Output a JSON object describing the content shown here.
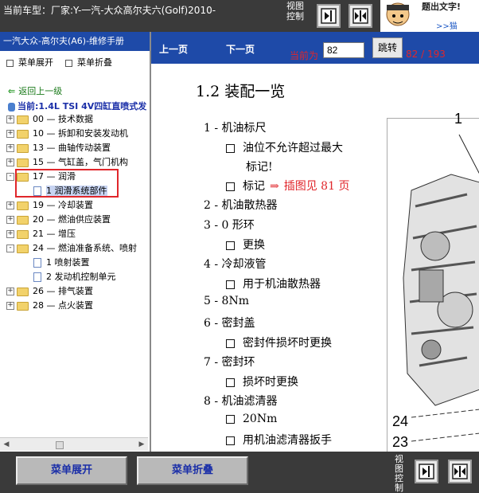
{
  "topbar": {
    "model_label": "当前车型：厂家:Y-一汽-大众高尔夫六(Golf)2010-",
    "view_control": "视图控制",
    "ad_text": "题出文字!",
    "ad_link": ">>猫"
  },
  "left_panel": {
    "header": "一汽大众-高尔夫(A6)-维修手册",
    "expand_label": "菜单展开",
    "collapse_label": "菜单折叠",
    "back_label": "返回上一级",
    "current_label": "当前:1.4L TSI 4V四缸直喷式发",
    "tree": [
      {
        "label": "00 — 技术数据",
        "type": "folder",
        "state": "+"
      },
      {
        "label": "10 — 拆卸和安装发动机",
        "type": "folder",
        "state": "+"
      },
      {
        "label": "13 — 曲轴传动装置",
        "type": "folder",
        "state": "+"
      },
      {
        "label": "15 — 气缸盖，气门机构",
        "type": "folder",
        "state": "+"
      },
      {
        "label": "17 — 润滑",
        "type": "folder",
        "state": "-"
      },
      {
        "label": "1 润滑系统部件",
        "type": "doc",
        "selected": true
      },
      {
        "label": "19 — 冷却装置",
        "type": "folder",
        "state": "+"
      },
      {
        "label": "20 — 燃油供应装置",
        "type": "folder",
        "state": "+"
      },
      {
        "label": "21 — 增压",
        "type": "folder",
        "state": "+"
      },
      {
        "label": "24 — 燃油准备系统、喷射",
        "type": "folder",
        "state": "-"
      },
      {
        "label": "1 喷射装置",
        "type": "doc"
      },
      {
        "label": "2 发动机控制单元",
        "type": "doc"
      },
      {
        "label": "26 — 排气装置",
        "type": "folder",
        "state": "+"
      },
      {
        "label": "28 — 点火装置",
        "type": "folder",
        "state": "+"
      }
    ]
  },
  "content_toolbar": {
    "prev_label": "上一页",
    "next_label": "下一页",
    "current_prefix": "当前为",
    "page_value": "82",
    "goto_label": "跳转",
    "page_count": "82 / 193"
  },
  "document": {
    "title": "1.2   装配一览",
    "items": [
      {
        "kind": "main",
        "text": "1 - 机油标尺"
      },
      {
        "kind": "sub",
        "text": "油位不允许超过最大"
      },
      {
        "kind": "cont",
        "text": "标记!"
      },
      {
        "kind": "sub",
        "text": "标记",
        "arrow": "⇒",
        "ref": "插图见 81 页"
      },
      {
        "kind": "main",
        "text": "2 - 机油散热器"
      },
      {
        "kind": "main",
        "text": "3 - 0 形环"
      },
      {
        "kind": "sub",
        "text": "更换"
      },
      {
        "kind": "main",
        "text": "4 - 冷却液管"
      },
      {
        "kind": "sub",
        "text": "用于机油散热器"
      },
      {
        "kind": "main",
        "text": "5 - 8Nm"
      },
      {
        "kind": "main",
        "text": "6 - 密封盖"
      },
      {
        "kind": "sub",
        "text": "密封件损坏时更换"
      },
      {
        "kind": "main",
        "text": "7 - 密封环"
      },
      {
        "kind": "sub",
        "text": "损坏时更换"
      },
      {
        "kind": "main",
        "text": "8 - 机油滤清器"
      },
      {
        "kind": "sub",
        "text": "20Nm"
      },
      {
        "kind": "sub",
        "text": "用机油滤清器扳手"
      }
    ],
    "figure_labels": [
      "1",
      "24",
      "23"
    ]
  },
  "bottombar": {
    "expand_label": "菜单展开",
    "collapse_label": "菜单折叠",
    "view_control": "视图控制"
  }
}
